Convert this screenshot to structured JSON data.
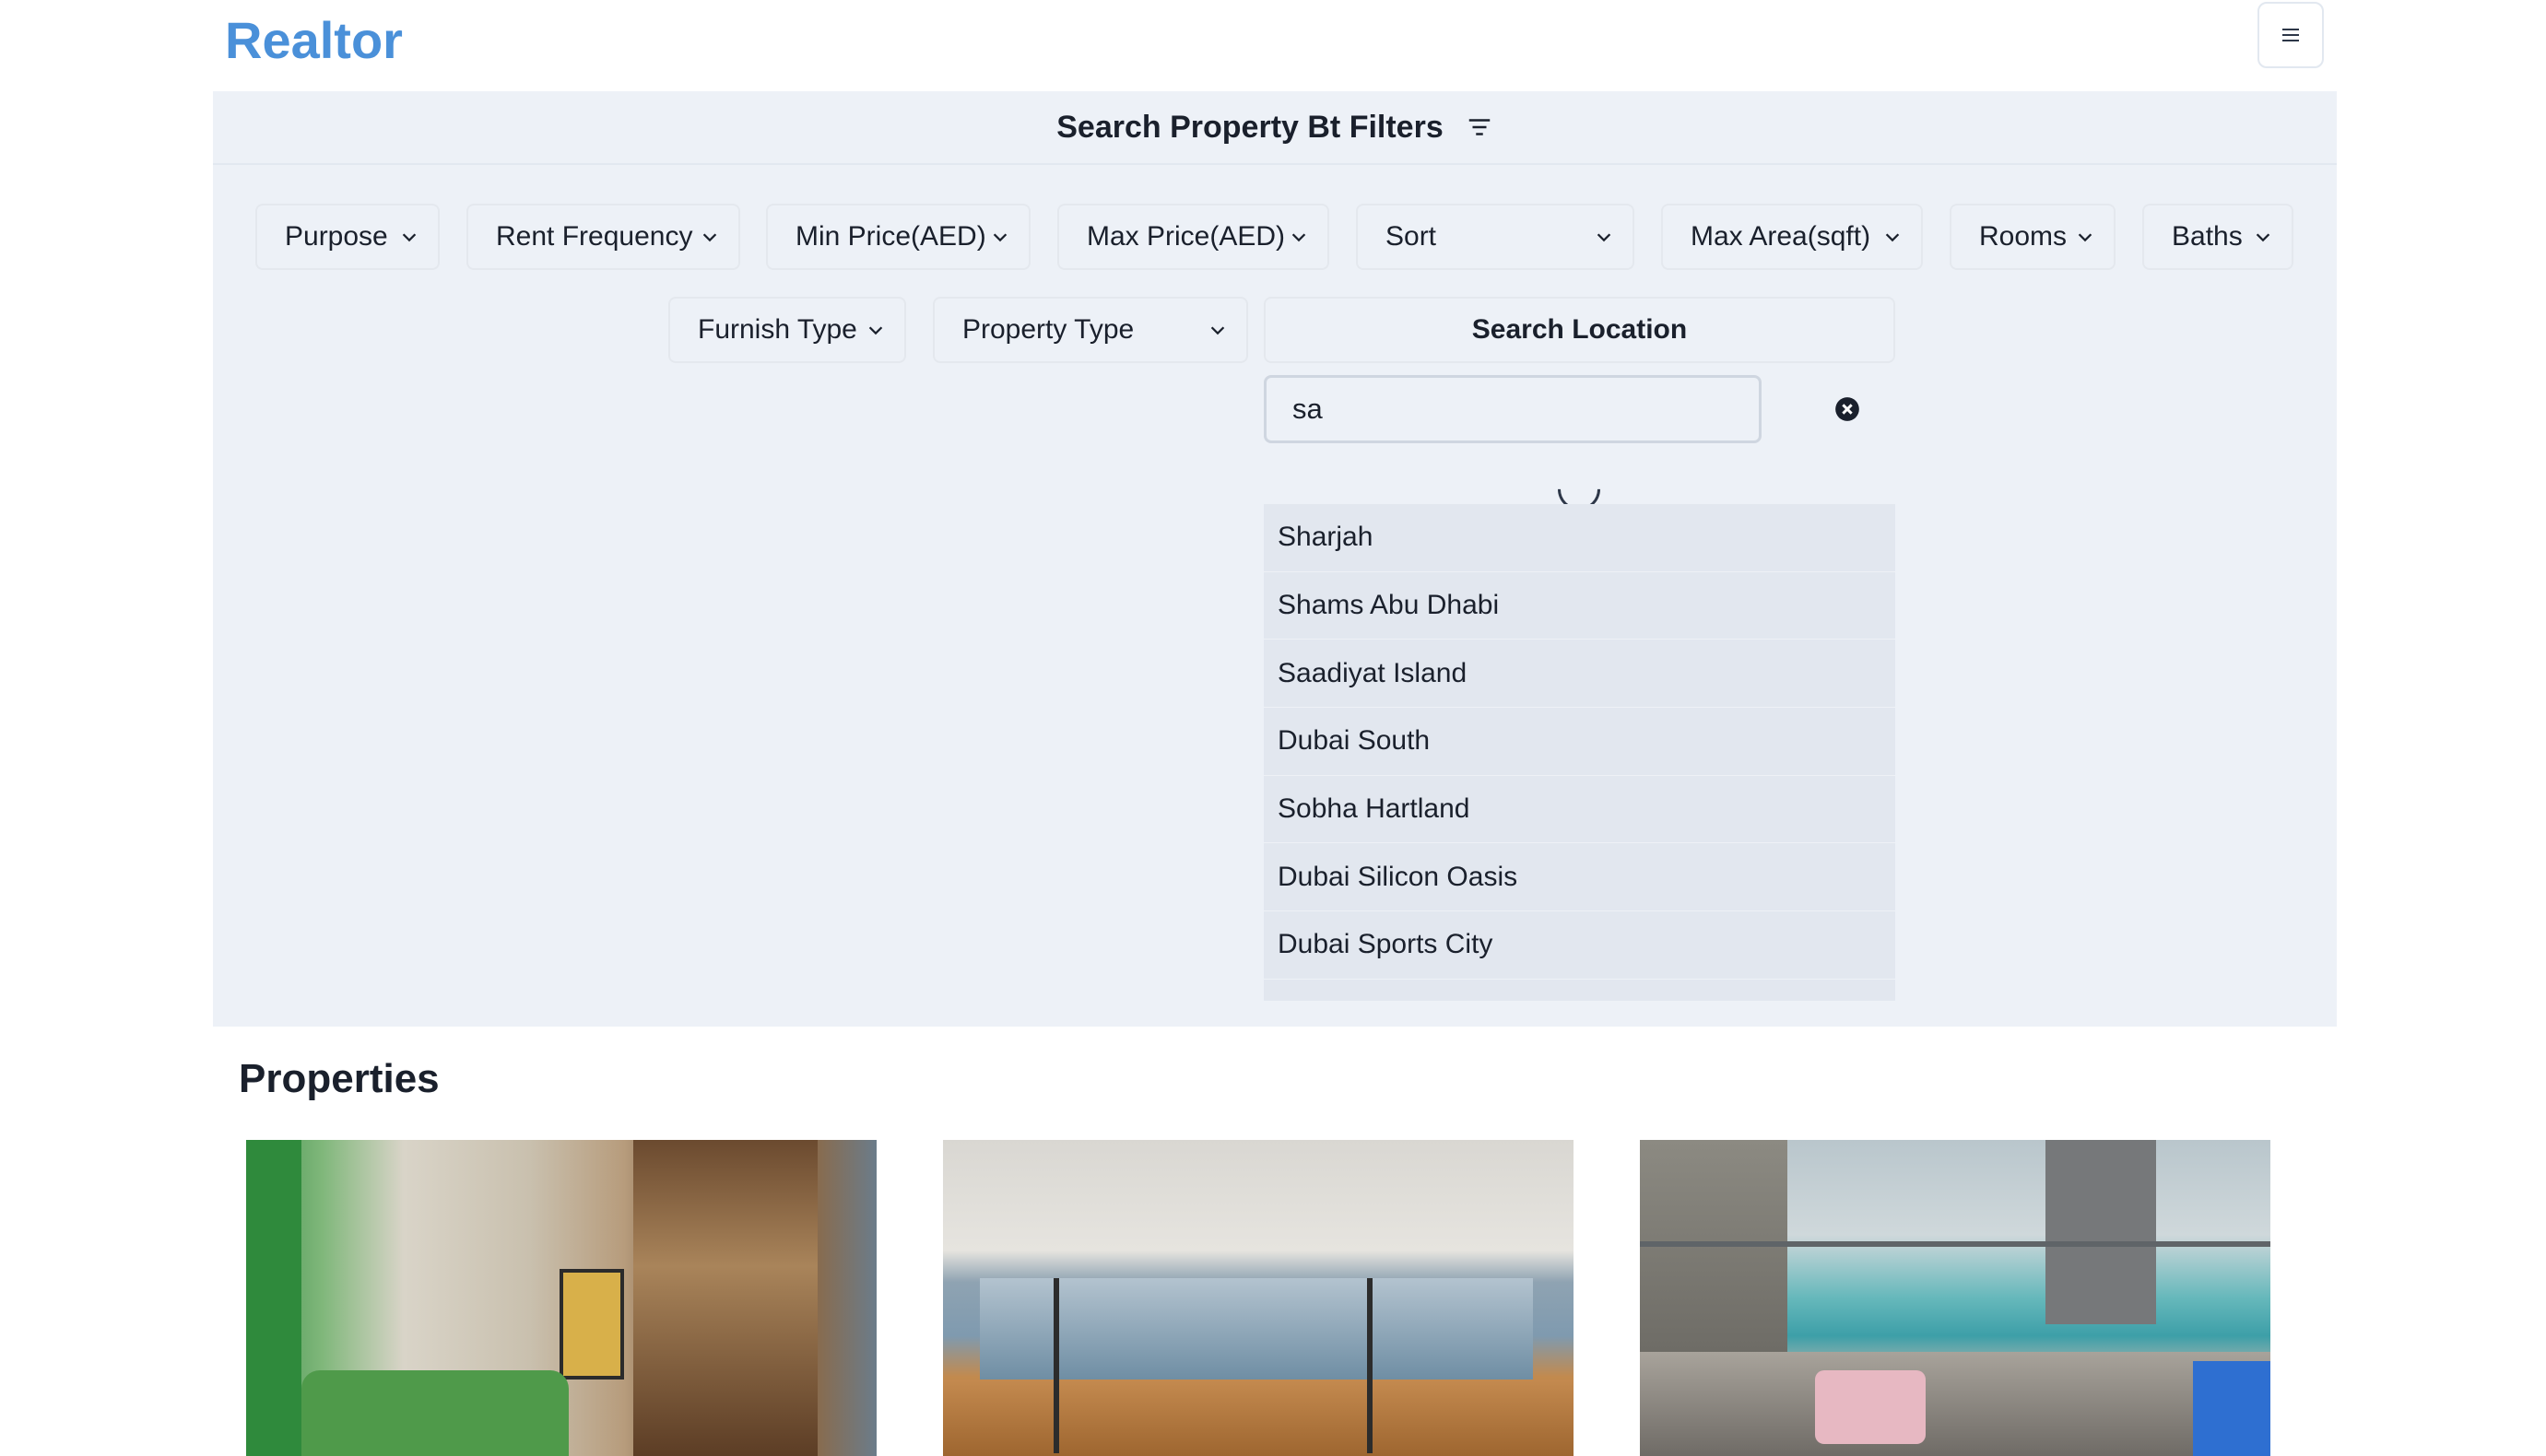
{
  "header": {
    "logo": "Realtor",
    "menu_icon": "hamburger-icon"
  },
  "filters": {
    "heading": "Search Property Bt Filters",
    "heading_icon": "filter-icon",
    "row1": [
      {
        "label": "Purpose"
      },
      {
        "label": "Rent Frequency"
      },
      {
        "label": "Min Price(AED)"
      },
      {
        "label": "Max Price(AED)"
      },
      {
        "label": "Sort"
      },
      {
        "label": "Max Area(sqft)"
      },
      {
        "label": "Rooms"
      },
      {
        "label": "Baths"
      }
    ],
    "row2": [
      {
        "label": "Furnish Type"
      },
      {
        "label": "Property Type"
      }
    ],
    "search_location_label": "Search Location",
    "location_input_value": "sa",
    "clear_icon": "close-circle-icon",
    "suggestions": [
      "Sharjah",
      "Shams Abu Dhabi",
      "Saadiyat Island",
      "Dubai South",
      "Sobha Hartland",
      "Dubai Silicon Oasis",
      "Dubai Sports City"
    ]
  },
  "properties": {
    "heading": "Properties"
  },
  "colors": {
    "brand": "#4a90d9",
    "panel_bg": "#edf1f7",
    "suggestion_bg": "#e2e7ef"
  }
}
